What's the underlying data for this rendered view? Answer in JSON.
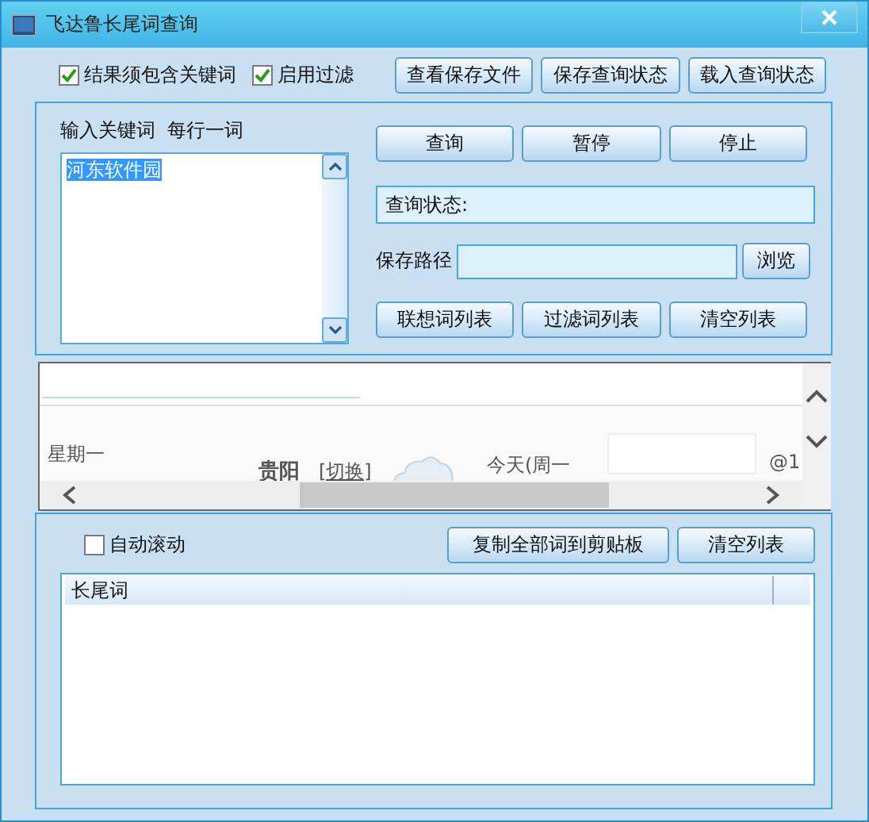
{
  "window": {
    "title": "飞达鲁长尾词查询"
  },
  "options": [
    {
      "label": "结果须包含关键词",
      "checked": true
    },
    {
      "label": "启用过滤",
      "checked": true
    }
  ],
  "top_buttons": [
    "查看保存文件",
    "保存查询状态",
    "载入查询状态"
  ],
  "keywords": {
    "label": "输入关键词  每行一词",
    "value": "河东软件园"
  },
  "action_buttons": [
    "查询",
    "暂停",
    "停止"
  ],
  "status": {
    "label": "查询状态:"
  },
  "save_path": {
    "label": "保存路径",
    "button": "浏览"
  },
  "list_buttons": [
    "联想词列表",
    "过滤词列表",
    "清空列表"
  ],
  "browser": {
    "day": "星期一",
    "city": "贵阳",
    "switch_link": "[切换]",
    "today": "今天(周一",
    "email_suffix": "@1"
  },
  "results": {
    "auto_scroll": {
      "label": "自动滚动",
      "checked": false
    },
    "buttons": [
      "复制全部词到剪贴板",
      "清空列表"
    ],
    "columns": [
      "长尾词"
    ]
  }
}
